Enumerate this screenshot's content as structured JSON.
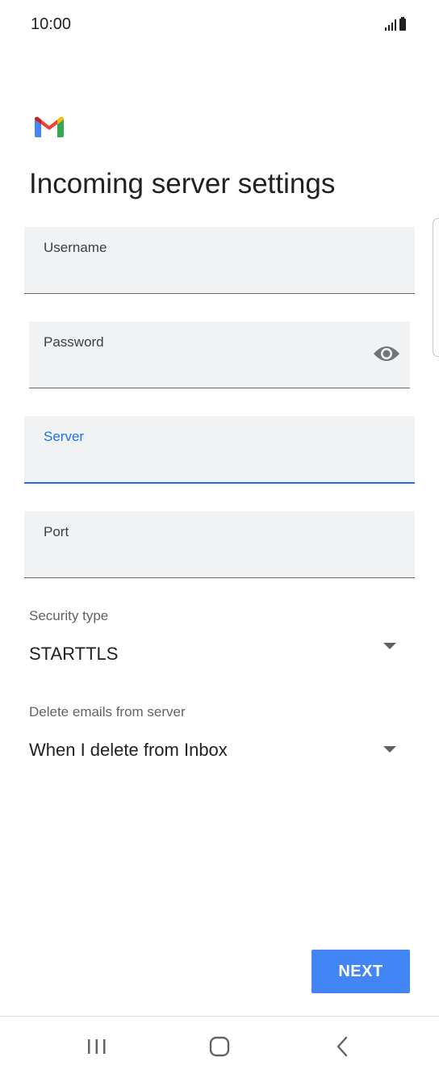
{
  "status_bar": {
    "time": "10:00",
    "icons": [
      "signal-icon",
      "battery-icon"
    ]
  },
  "app": {
    "logo": "gmail-logo",
    "title": "Incoming server settings"
  },
  "form": {
    "username": {
      "label": "Username",
      "value": ""
    },
    "password": {
      "label": "Password",
      "value": "",
      "toggle_icon": "eye-icon"
    },
    "server": {
      "label": "Server",
      "value": "",
      "focused": true
    },
    "port": {
      "label": "Port",
      "value": ""
    },
    "security_type": {
      "label": "Security type",
      "value": "STARTTLS"
    },
    "delete_emails": {
      "label": "Delete emails from server",
      "value": "When I delete from Inbox"
    }
  },
  "actions": {
    "next_label": "NEXT"
  },
  "nav_bar": {
    "buttons": [
      "recent-apps-icon",
      "home-icon",
      "back-icon"
    ]
  },
  "colors": {
    "accent": "#1a73e8",
    "button": "#4285f4",
    "field_bg": "#f1f2f4",
    "text": "#202124"
  }
}
